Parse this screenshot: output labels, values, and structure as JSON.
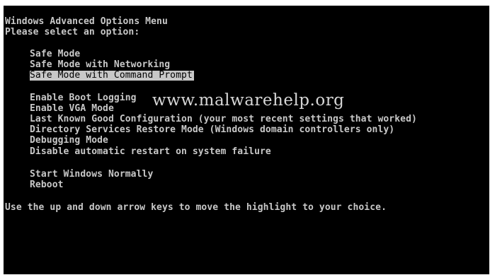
{
  "menu": {
    "title": "Windows Advanced Options Menu",
    "prompt": "Please select an option:",
    "group1": [
      {
        "label": "Safe Mode"
      },
      {
        "label": "Safe Mode with Networking"
      },
      {
        "label": "Safe Mode with Command Prompt",
        "selected": true
      }
    ],
    "group2": [
      {
        "label": "Enable Boot Logging"
      },
      {
        "label": "Enable VGA Mode"
      },
      {
        "label": "Last Known Good Configuration (your most recent settings that worked)"
      },
      {
        "label": "Directory Services Restore Mode (Windows domain controllers only)"
      },
      {
        "label": "Debugging Mode"
      },
      {
        "label": "Disable automatic restart on system failure"
      }
    ],
    "group3": [
      {
        "label": "Start Windows Normally"
      },
      {
        "label": "Reboot"
      }
    ],
    "instructions": "Use the up and down arrow keys to move the highlight to your choice."
  },
  "watermark": "www.malwarehelp.org",
  "colors": {
    "background": "#000000",
    "text": "#c8c8c8",
    "highlight": "#c8c8c8",
    "highlight_text": "#000000",
    "frame": "#ffffff"
  }
}
